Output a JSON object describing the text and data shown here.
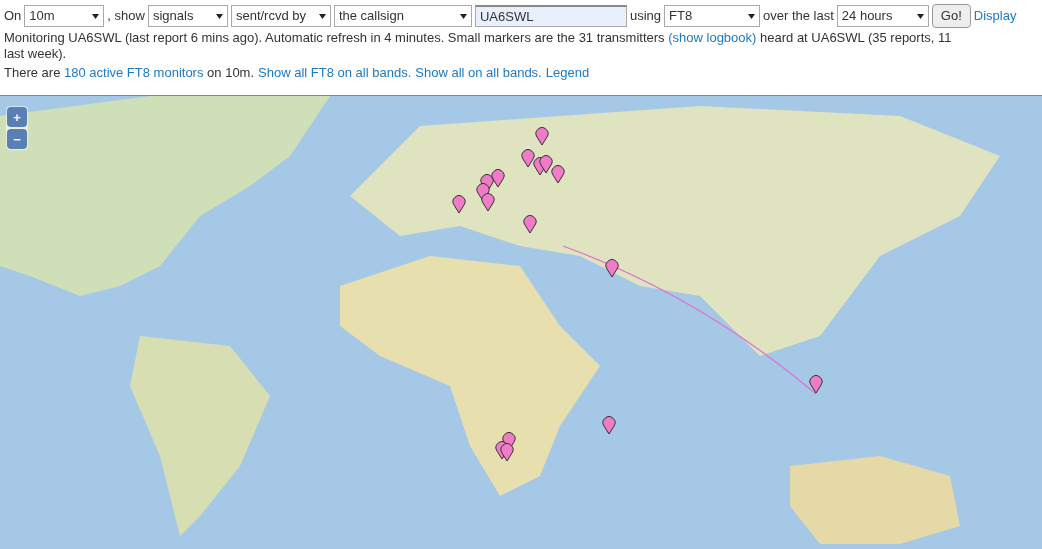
{
  "toolbar": {
    "prefix": "On",
    "band": "10m",
    "show_label": ", show",
    "show": "signals",
    "direction": "sent/rcvd by",
    "target": "the callsign",
    "callsign": "UA6SWL",
    "using_label": "using",
    "mode": "FT8",
    "period_label": "over the last",
    "period": "24 hours",
    "go": "Go!",
    "display": "Display"
  },
  "status": {
    "before": "Monitoring UA6SWL (last report 6 mins ago). Automatic refresh in 4 minutes. Small markers are the 31 transmitters",
    "link": "(show logbook)",
    "after": "heard at UA6SWL (35 reports, 11",
    "continued": "last week)."
  },
  "monitors": {
    "before": "There are",
    "link": "180 active FT8 monitors",
    "after": "on 10m.",
    "links": [
      "Show all FT8 on all bands.",
      "Show all on all bands.",
      "Legend"
    ]
  },
  "map": {
    "zoom_in": "+",
    "zoom_out": "−"
  }
}
